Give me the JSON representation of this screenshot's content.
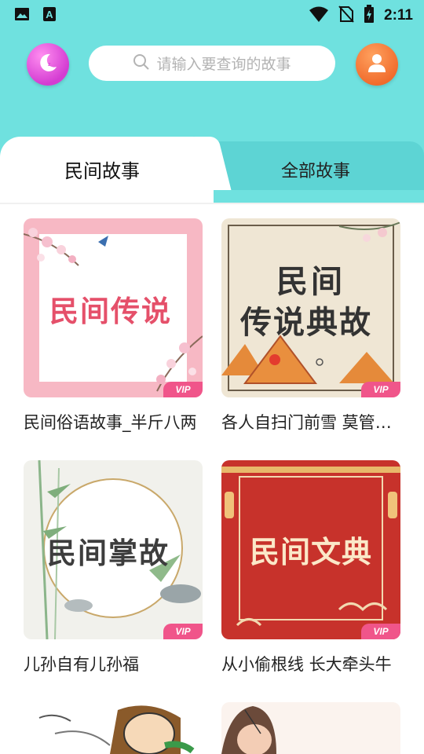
{
  "status_bar": {
    "time": "2:11",
    "icons": [
      "image-icon",
      "accessibility-a-icon",
      "wifi-icon",
      "no-sim-icon",
      "battery-charging-icon"
    ]
  },
  "header": {
    "left_button_icon": "moon-icon",
    "search_placeholder": "请输入要查询的故事",
    "right_button_icon": "user-icon"
  },
  "tabs": [
    {
      "label": "民间故事",
      "active": true
    },
    {
      "label": "全部故事",
      "active": false
    }
  ],
  "cards": [
    {
      "cover_text": "民间传说",
      "badge": "VIP",
      "caption": "民间俗语故事_半斤八两"
    },
    {
      "cover_text": [
        "民间",
        "传说典故"
      ],
      "badge": "VIP",
      "caption": "各人自扫门前雪 莫管他人瓦上霜"
    },
    {
      "cover_text": "民间掌故",
      "badge": "VIP",
      "caption": "儿孙自有儿孙福"
    },
    {
      "cover_text": "民间文典",
      "badge": "VIP",
      "caption": "从小偷根线 长大牵头牛"
    }
  ],
  "colors": {
    "header_bg": "#6fe1df",
    "inactive_tab_bg": "#5dd4d4",
    "vip_badge": "#f0558a",
    "moon_button": "#d43cd2",
    "user_button": "#f06a2b"
  }
}
